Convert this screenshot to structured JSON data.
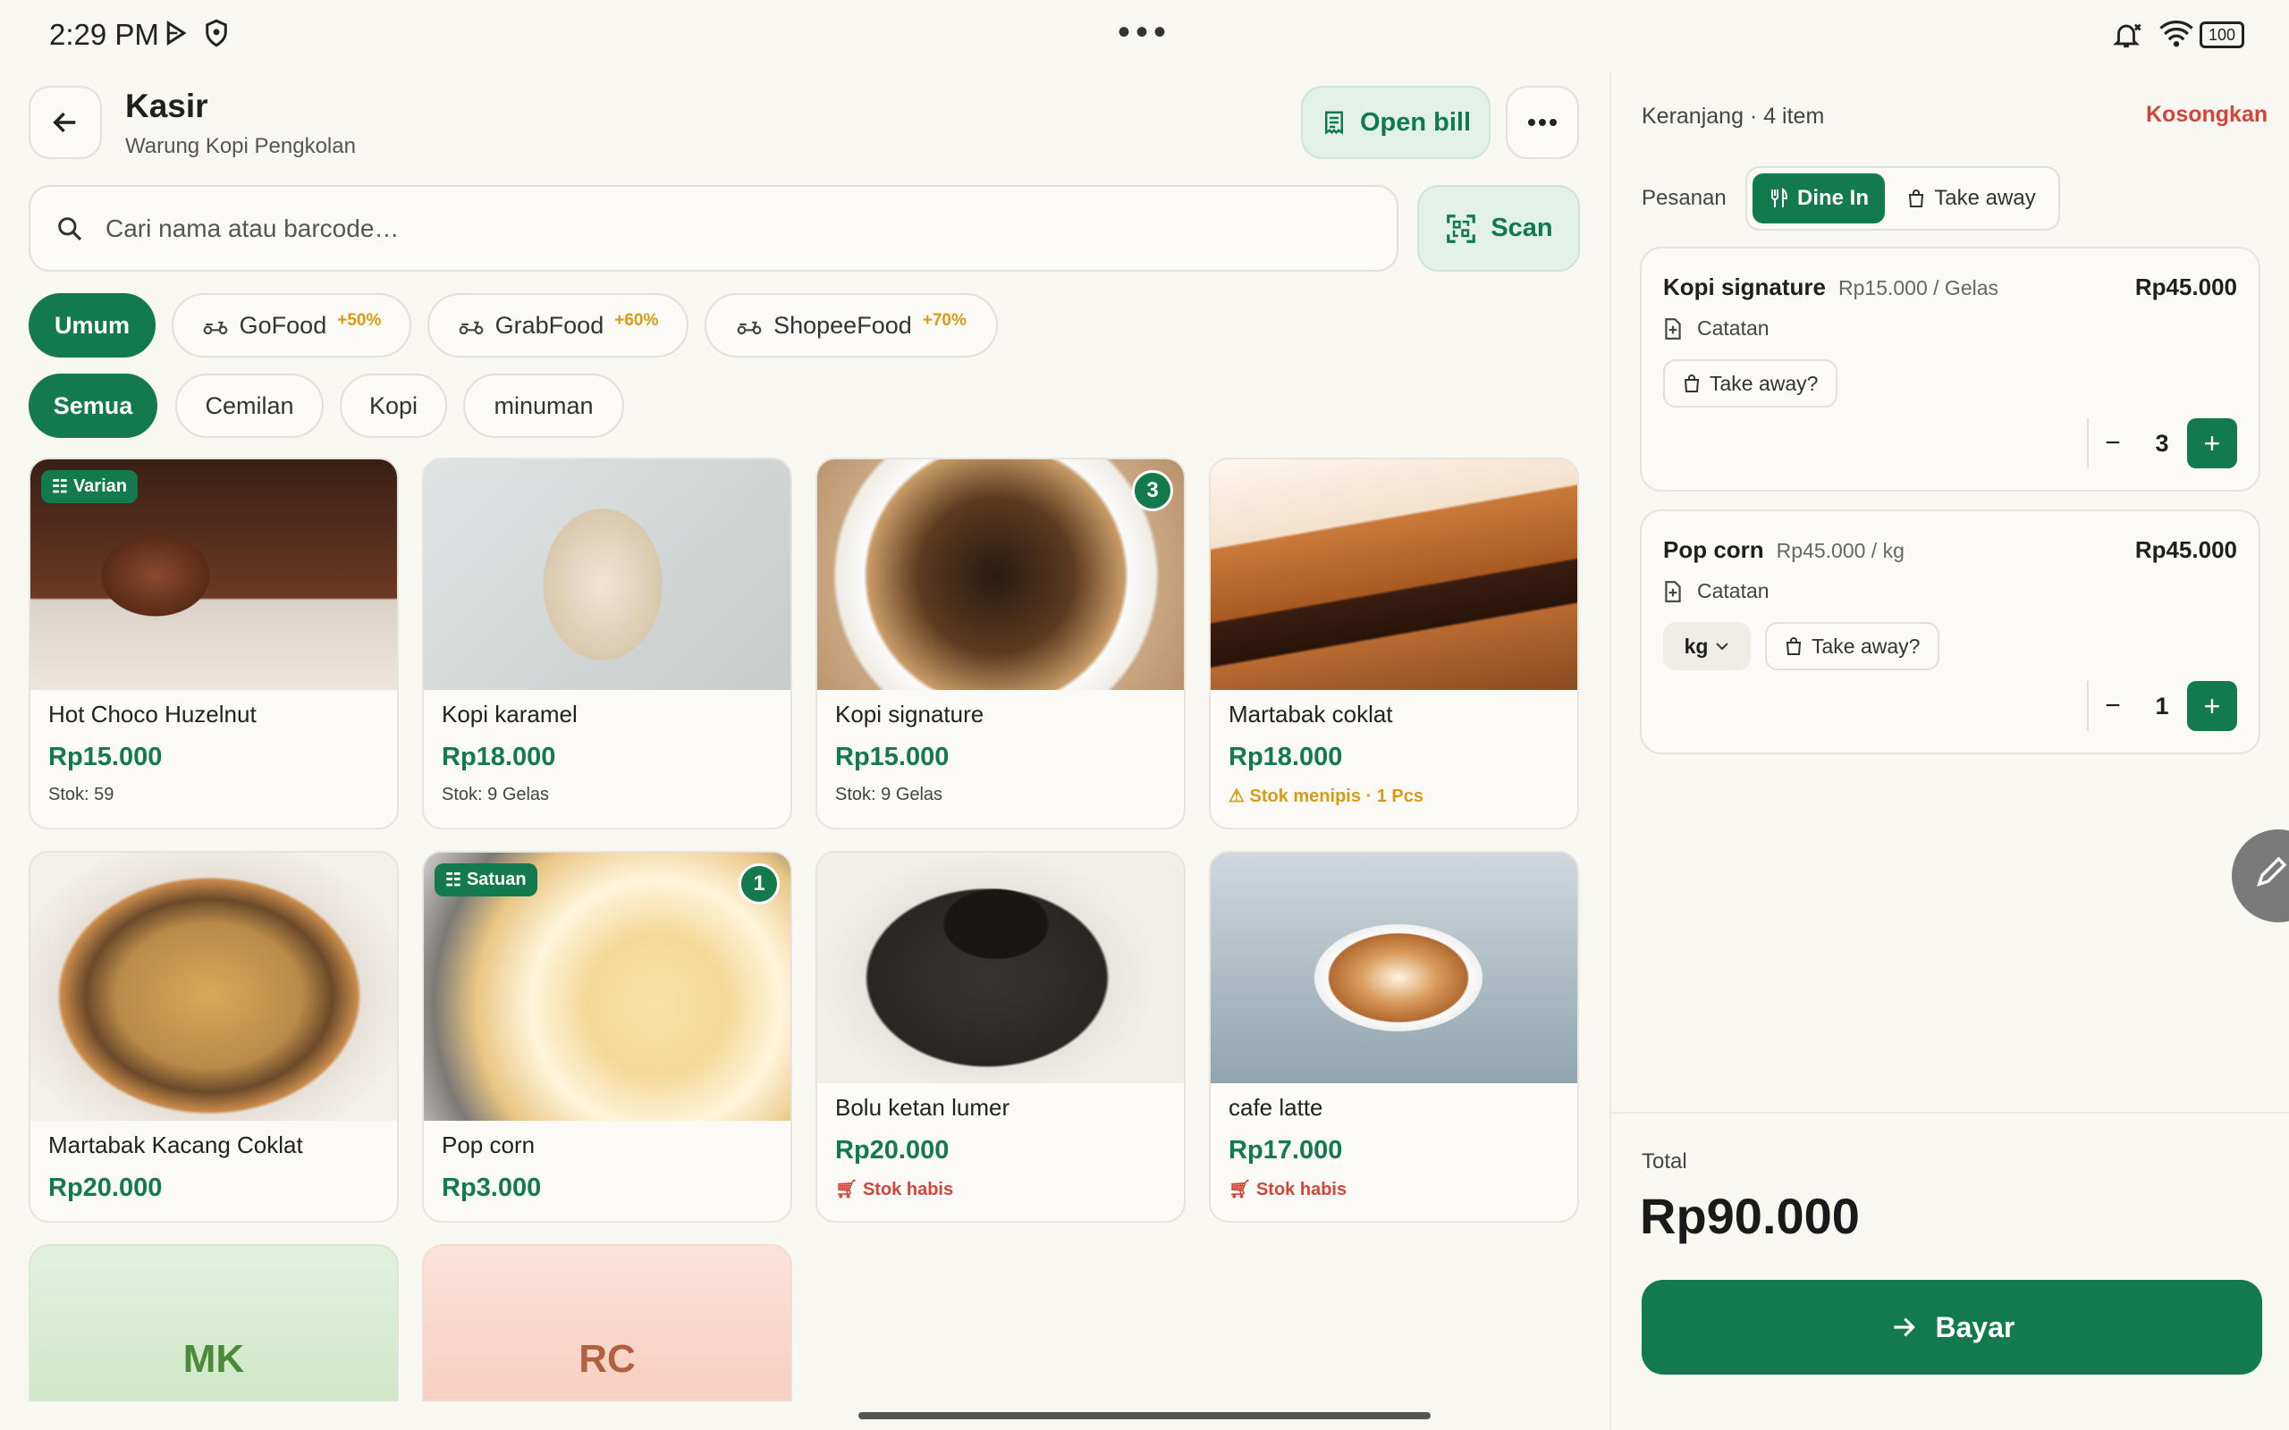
{
  "status_bar": {
    "time": "2:29 PM",
    "battery": "100"
  },
  "header": {
    "title": "Kasir",
    "subtitle": "Warung Kopi Pengkolan",
    "open_bill_label": "Open bill"
  },
  "search": {
    "placeholder": "Cari nama atau barcode…",
    "scan_label": "Scan"
  },
  "price_channels": [
    {
      "label": "Umum",
      "pct": ""
    },
    {
      "label": "GoFood",
      "pct": "+50%"
    },
    {
      "label": "GrabFood",
      "pct": "+60%"
    },
    {
      "label": "ShopeeFood",
      "pct": "+70%"
    }
  ],
  "categories": [
    "Semua",
    "Cemilan",
    "Kopi",
    "minuman"
  ],
  "products": [
    {
      "name": "Hot Choco Huzelnut",
      "price": "Rp15.000",
      "stock": "Stok: 59",
      "tag": "Varian"
    },
    {
      "name": "Kopi karamel",
      "price": "Rp18.000",
      "stock": "Stok: 9 Gelas"
    },
    {
      "name": "Kopi signature",
      "price": "Rp15.000",
      "stock": "Stok: 9 Gelas",
      "count": "3"
    },
    {
      "name": "Martabak coklat",
      "price": "Rp18.000",
      "stock": "Stok menipis · 1 Pcs"
    },
    {
      "name": "Martabak Kacang Coklat",
      "price": "Rp20.000"
    },
    {
      "name": "Pop corn",
      "price": "Rp3.000",
      "tag": "Satuan",
      "count": "1"
    },
    {
      "name": "Bolu ketan lumer",
      "price": "Rp20.000",
      "stock": "Stok habis"
    },
    {
      "name": "cafe latte",
      "price": "Rp17.000",
      "stock": "Stok habis"
    }
  ],
  "placeholder_tiles": [
    "MK",
    "RC"
  ],
  "cart": {
    "title": "Keranjang · 4 item",
    "clear_label": "Kosongkan",
    "order_label": "Pesanan",
    "dine_in": "Dine In",
    "take_away": "Take away",
    "items": [
      {
        "name": "Kopi signature",
        "unit_price": "Rp15.000 / Gelas",
        "subtotal": "Rp45.000",
        "note": "Catatan",
        "takeaway": "Take away?",
        "qty": "3"
      },
      {
        "name": "Pop corn",
        "unit_price": "Rp45.000 / kg",
        "subtotal": "Rp45.000",
        "note": "Catatan",
        "unit": "kg",
        "takeaway": "Take away?",
        "qty": "1"
      }
    ],
    "total_label": "Total",
    "total_value": "Rp90.000",
    "pay_label": "Bayar"
  },
  "colors": {
    "primary": "#127a4d",
    "warning": "#d99a14",
    "danger": "#d2453a",
    "background": "#f8f7f2"
  }
}
